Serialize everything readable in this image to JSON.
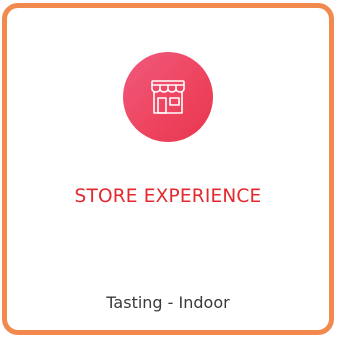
{
  "card": {
    "icon": "store-icon",
    "title": "STORE EXPERIENCE",
    "subtitle": "Tasting - Indoor"
  },
  "colors": {
    "border": "#f2894f",
    "icon_bg": "#ee4560",
    "title": "#e5282e",
    "subtitle": "#3a3a3a"
  }
}
